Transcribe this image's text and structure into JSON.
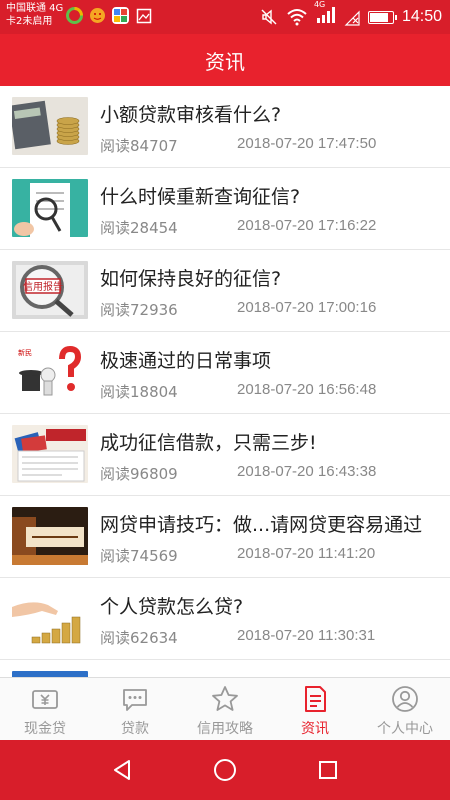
{
  "status_bar": {
    "carrier_line1": "中国联通 4G",
    "carrier_line2": "卡2未启用",
    "time": "14:50",
    "network_label": "4G",
    "battery_level": 0.85
  },
  "header": {
    "title": "资讯"
  },
  "articles": [
    {
      "title": "小额贷款审核看什么?",
      "reads": "阅读84707",
      "date": "2018-07-20 17:47:50",
      "thumb": "coins-calculator"
    },
    {
      "title": "什么时候重新查询征信?",
      "reads": "阅读28454",
      "date": "2018-07-20 17:16:22",
      "thumb": "magnifier-document"
    },
    {
      "title": "如何保持良好的征信?",
      "reads": "阅读72936",
      "date": "2018-07-20 17:00:16",
      "thumb": "credit-report"
    },
    {
      "title": "极速通过的日常事项",
      "reads": "阅读18804",
      "date": "2018-07-20 16:56:48",
      "thumb": "question-mark"
    },
    {
      "title": "成功征信借款，只需三步!",
      "reads": "阅读96809",
      "date": "2018-07-20 16:43:38",
      "thumb": "cards-document"
    },
    {
      "title": "网贷申请技巧：做...请网贷更容易通过",
      "reads": "阅读74569",
      "date": "2018-07-20 11:41:20",
      "thumb": "banner"
    },
    {
      "title": "个人贷款怎么贷?",
      "reads": "阅读62634",
      "date": "2018-07-20 11:30:31",
      "thumb": "hand-coins"
    }
  ],
  "tabs": [
    {
      "label": "现金贷",
      "icon": "cash-icon"
    },
    {
      "label": "贷款",
      "icon": "chat-icon"
    },
    {
      "label": "信用攻略",
      "icon": "star-icon"
    },
    {
      "label": "资讯",
      "icon": "news-icon",
      "active": true
    },
    {
      "label": "个人中心",
      "icon": "user-icon"
    }
  ],
  "colors": {
    "brand_red": "#e8222d",
    "status_red": "#d81e2a",
    "inactive_gray": "#999999"
  }
}
